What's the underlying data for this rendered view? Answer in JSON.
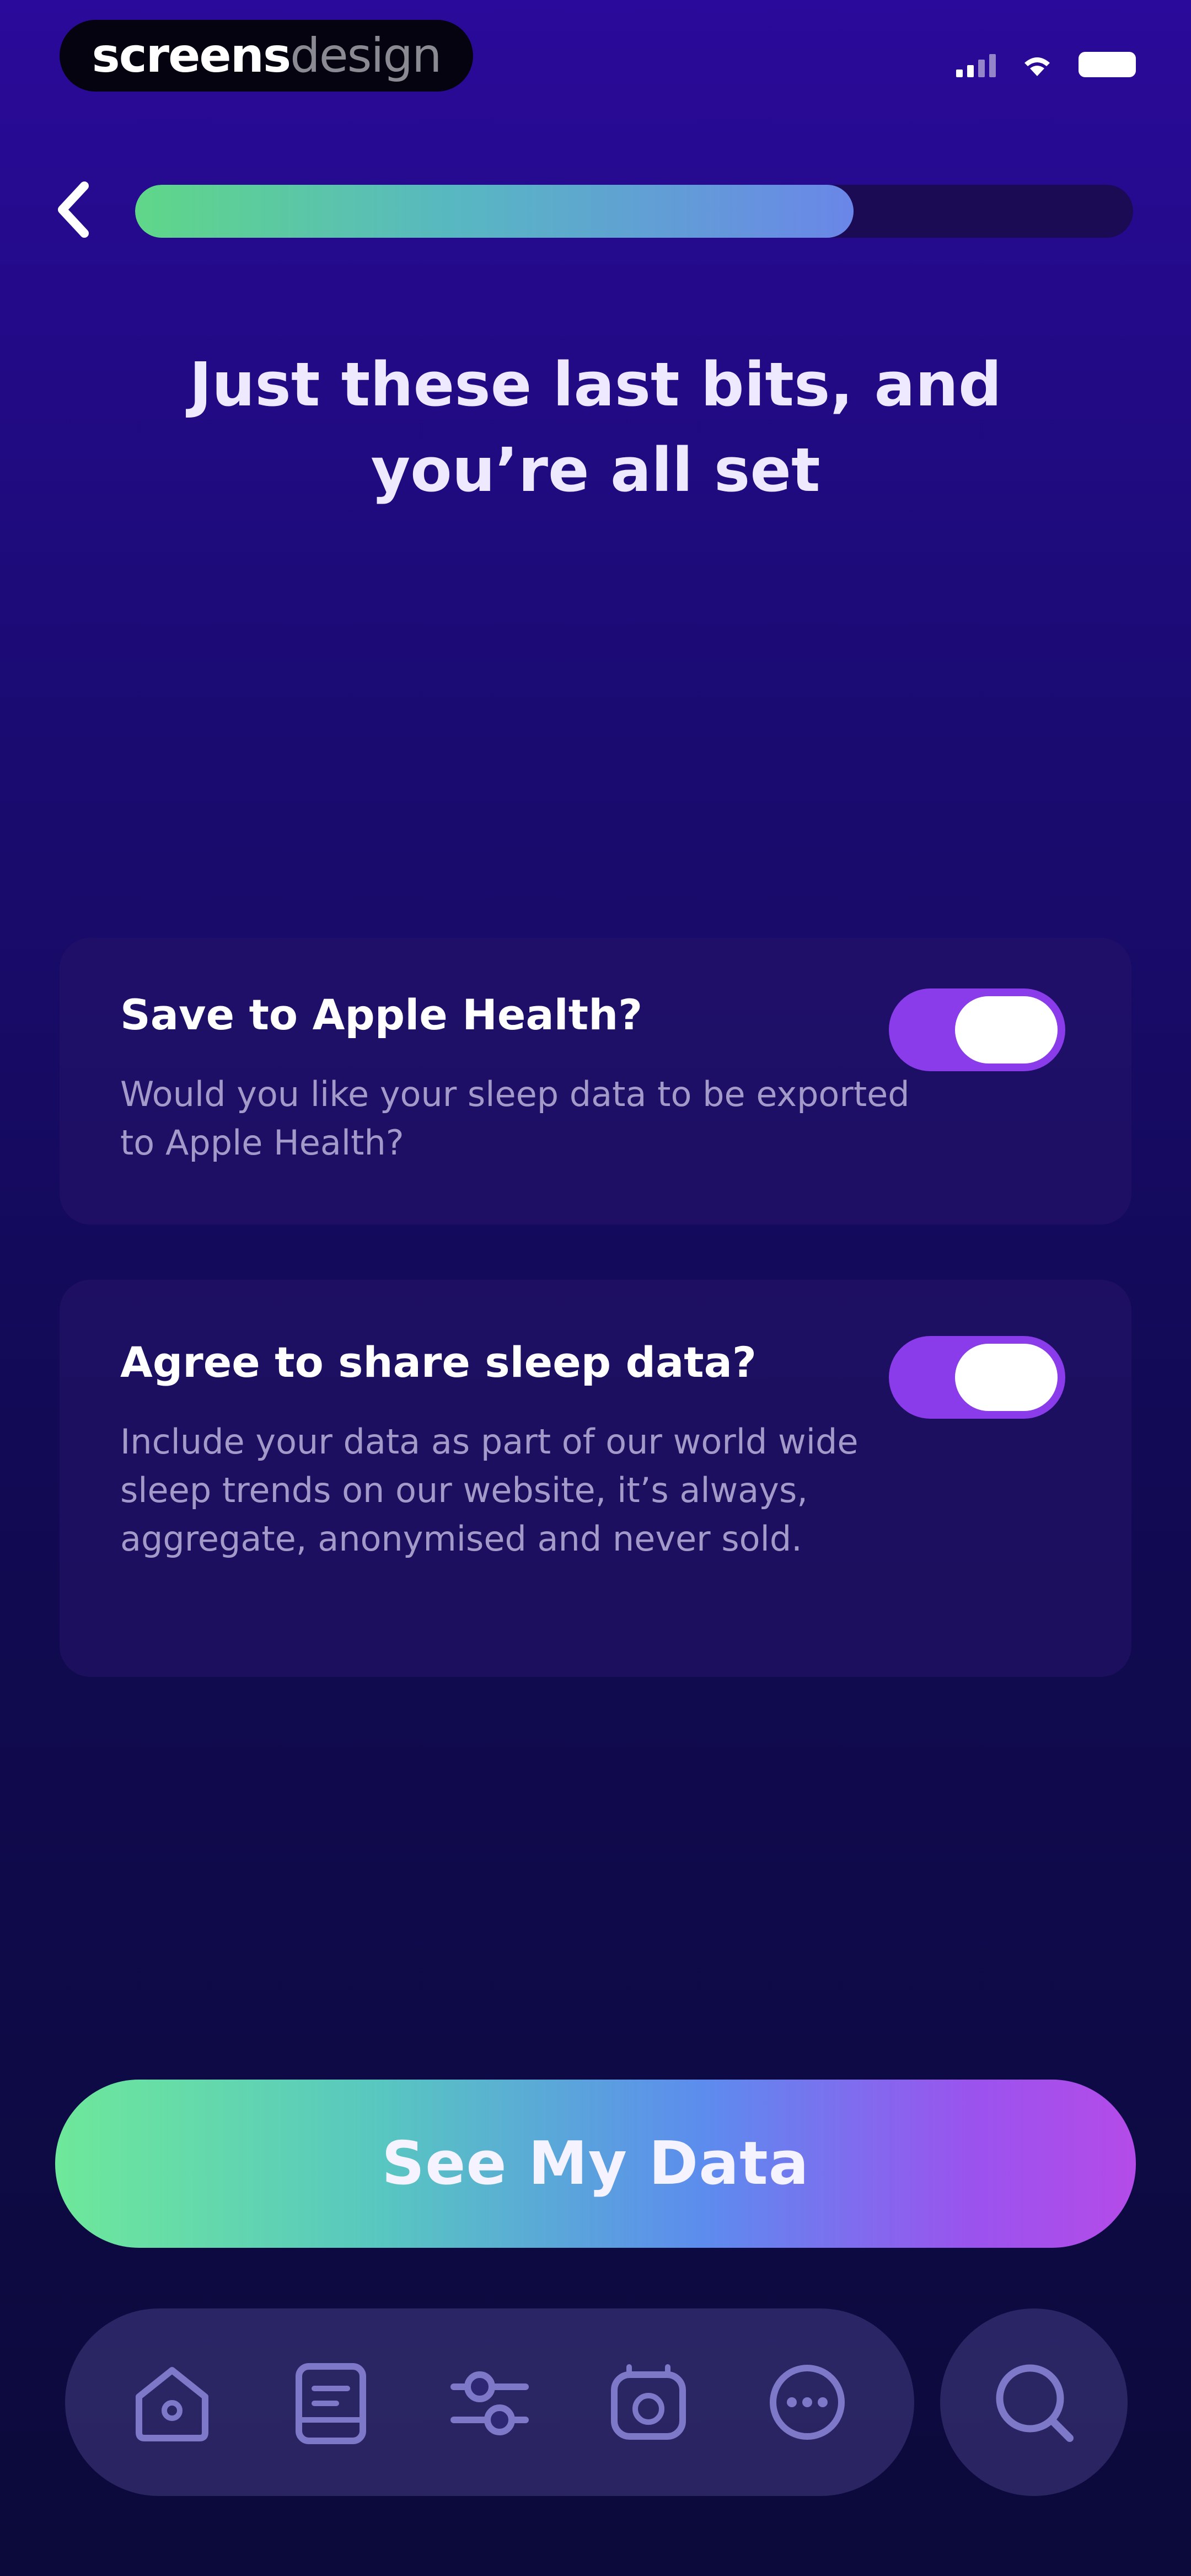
{
  "brand": {
    "strong": "screens",
    "light": "design"
  },
  "progress": {
    "fraction": 0.72
  },
  "title": "Just these last bits, and you’re all set",
  "settings": [
    {
      "title": "Save to Apple Health?",
      "description": "Would you like your sleep data to be exported to Apple Health?",
      "enabled": true
    },
    {
      "title": "Agree to share sleep data?",
      "description": "Include your data as part of our world wide sleep trends on our website, it’s always, aggregate, anonymised and never sold.",
      "enabled": true
    }
  ],
  "cta": {
    "label": "See My Data"
  },
  "nav": {
    "items": [
      "home-icon",
      "journal-icon",
      "sliders-icon",
      "alarm-icon",
      "more-icon"
    ],
    "search": "search-icon"
  },
  "colors": {
    "toggle_on": "#8a3bea",
    "progress_start": "#5fd788",
    "progress_end": "#6a86e8",
    "cta_start": "#6ee89a",
    "cta_end": "#b44be8"
  }
}
